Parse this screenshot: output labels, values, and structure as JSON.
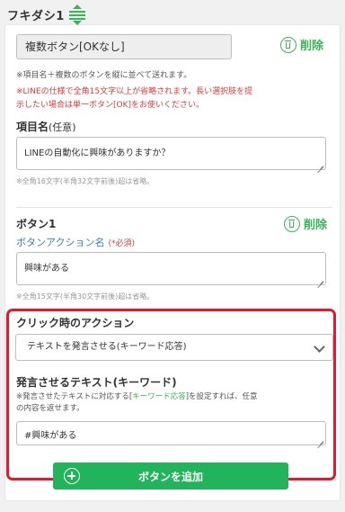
{
  "header": {
    "title": "フキダシ1"
  },
  "message_type": {
    "value": "複数ボタン[OKなし]"
  },
  "delete_label": "削除",
  "notes": {
    "type_info": "※項目名＋複数のボタンを縦に並べて送れます。",
    "warning_line1": "※LINEの仕様で全角15文字以上が省略されます。長い選択肢を提",
    "warning_line2": "示したい場合は単一ボタン[OK]をお使いください。"
  },
  "item_name": {
    "label": "項目名",
    "optional": "(任意)",
    "value": "LINEの自動化に興味がありますか？",
    "hint": "※全角16文字(半角32文字前後)超は省略。"
  },
  "button1": {
    "label": "ボタン1",
    "action_name_label": "ボタンアクション名",
    "required": "(*必須)",
    "value": "興味がある",
    "hint": "※全角15文字(半角30文字前後)超は省略。"
  },
  "click_action": {
    "label": "クリック時のアクション",
    "selected": "テキストを発言させる(キーワード応答)"
  },
  "speech_text": {
    "label": "発言させるテキスト(キーワード)",
    "note_prefix": "※発言させたテキストに対応する[",
    "note_link": "キーワード応答",
    "note_suffix": "]を設定すれば、任意",
    "note_line2": "の内容を返せます。",
    "value": "#興味がある"
  },
  "add_button": {
    "label": "ボタンを追加"
  },
  "colors": {
    "accent": "#3cb35a",
    "add_button": "#21b45a",
    "highlight": "#e5192b",
    "warning": "#e03a3a",
    "link_blue": "#3a7dc9"
  }
}
